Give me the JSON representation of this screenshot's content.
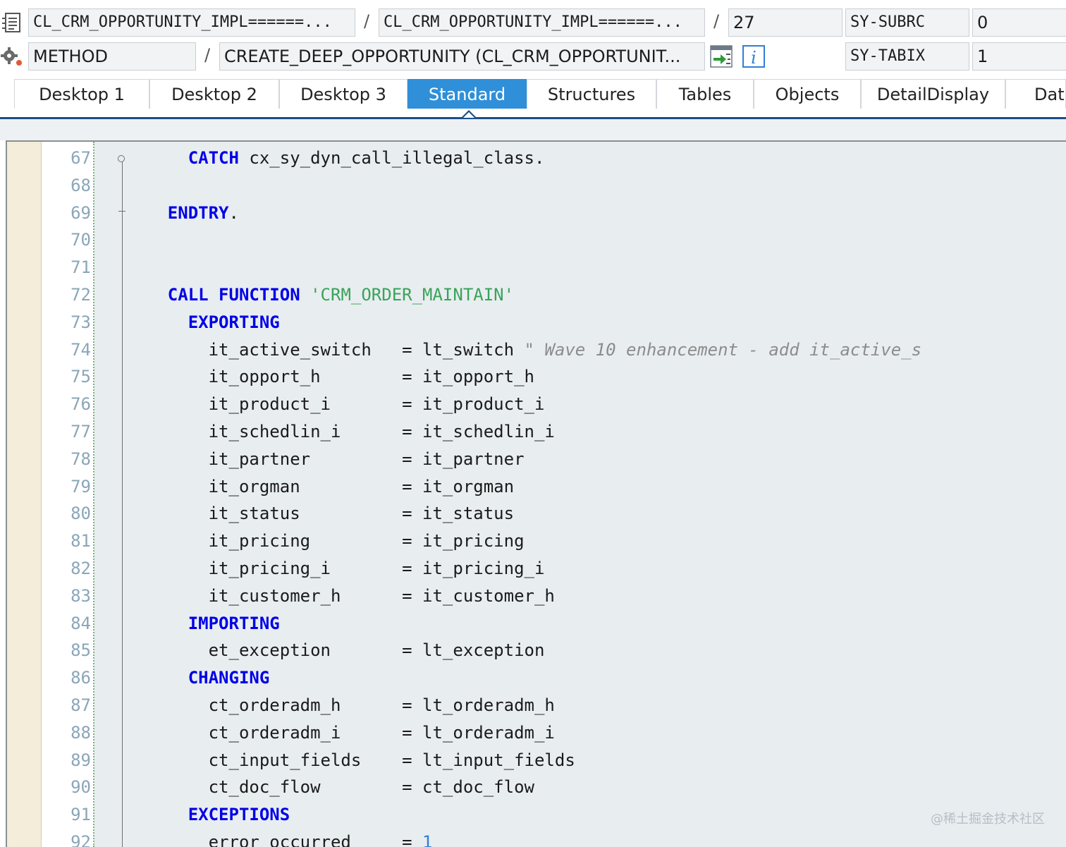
{
  "header": {
    "row1": {
      "program": "CL_CRM_OPPORTUNITY_IMPL======...",
      "include": "CL_CRM_OPPORTUNITY_IMPL======...",
      "line": "27",
      "sysvar_name": "SY-SUBRC",
      "sysvar_value": "0",
      "separator": "/",
      "icon": "source-code-icon"
    },
    "row2": {
      "event_type": "METHOD",
      "event_name": "CREATE_DEEP_OPPORTUNITY (CL_CRM_OPPORTUNIT...",
      "sysvar_name": "SY-TABIX",
      "sysvar_value": "1",
      "separator": "/",
      "icon": "gear-icon",
      "buttons": [
        "navigate-icon",
        "info-icon"
      ]
    }
  },
  "tabs": [
    {
      "label": "Desktop 1",
      "active": false
    },
    {
      "label": "Desktop 2",
      "active": false
    },
    {
      "label": "Desktop 3",
      "active": false
    },
    {
      "label": "Standard",
      "active": true
    },
    {
      "label": "Structures",
      "active": false
    },
    {
      "label": "Tables",
      "active": false
    },
    {
      "label": "Objects",
      "active": false
    },
    {
      "label": "DetailDisplay",
      "active": false
    },
    {
      "label": "Data",
      "active": false
    }
  ],
  "editor": {
    "lines": [
      {
        "n": "67",
        "tokens": [
          [
            "ws",
            "      "
          ],
          [
            "kw",
            "CATCH"
          ],
          [
            "id",
            " cx_sy_dyn_call_illegal_class."
          ]
        ]
      },
      {
        "n": "68",
        "tokens": []
      },
      {
        "n": "69",
        "tokens": [
          [
            "ws",
            "    "
          ],
          [
            "kw",
            "ENDTRY"
          ],
          [
            "id",
            "."
          ]
        ]
      },
      {
        "n": "70",
        "tokens": []
      },
      {
        "n": "71",
        "tokens": []
      },
      {
        "n": "72",
        "tokens": [
          [
            "ws",
            "    "
          ],
          [
            "kw",
            "CALL FUNCTION"
          ],
          [
            "id",
            " "
          ],
          [
            "str",
            "'CRM_ORDER_MAINTAIN'"
          ]
        ]
      },
      {
        "n": "73",
        "tokens": [
          [
            "ws",
            "      "
          ],
          [
            "kw",
            "EXPORTING"
          ]
        ]
      },
      {
        "n": "74",
        "tokens": [
          [
            "id",
            "        it_active_switch   = lt_switch "
          ],
          [
            "cmt",
            "\" Wave 10 enhancement - add it_active_s"
          ]
        ]
      },
      {
        "n": "75",
        "tokens": [
          [
            "id",
            "        it_opport_h        = it_opport_h"
          ]
        ]
      },
      {
        "n": "76",
        "tokens": [
          [
            "id",
            "        it_product_i       = it_product_i"
          ]
        ]
      },
      {
        "n": "77",
        "tokens": [
          [
            "id",
            "        it_schedlin_i      = it_schedlin_i"
          ]
        ]
      },
      {
        "n": "78",
        "tokens": [
          [
            "id",
            "        it_partner         = it_partner"
          ]
        ]
      },
      {
        "n": "79",
        "tokens": [
          [
            "id",
            "        it_orgman          = it_orgman"
          ]
        ]
      },
      {
        "n": "80",
        "tokens": [
          [
            "id",
            "        it_status          = it_status"
          ]
        ]
      },
      {
        "n": "81",
        "tokens": [
          [
            "id",
            "        it_pricing         = it_pricing"
          ]
        ]
      },
      {
        "n": "82",
        "tokens": [
          [
            "id",
            "        it_pricing_i       = it_pricing_i"
          ]
        ]
      },
      {
        "n": "83",
        "tokens": [
          [
            "id",
            "        it_customer_h      = it_customer_h"
          ]
        ]
      },
      {
        "n": "84",
        "tokens": [
          [
            "ws",
            "      "
          ],
          [
            "kw",
            "IMPORTING"
          ]
        ]
      },
      {
        "n": "85",
        "tokens": [
          [
            "id",
            "        et_exception       = lt_exception"
          ]
        ]
      },
      {
        "n": "86",
        "tokens": [
          [
            "ws",
            "      "
          ],
          [
            "kw",
            "CHANGING"
          ]
        ]
      },
      {
        "n": "87",
        "tokens": [
          [
            "id",
            "        ct_orderadm_h      = lt_orderadm_h"
          ]
        ]
      },
      {
        "n": "88",
        "tokens": [
          [
            "id",
            "        ct_orderadm_i      = lt_orderadm_i"
          ]
        ]
      },
      {
        "n": "89",
        "tokens": [
          [
            "id",
            "        ct_input_fields    = lt_input_fields"
          ]
        ]
      },
      {
        "n": "90",
        "tokens": [
          [
            "id",
            "        ct_doc_flow        = ct_doc_flow"
          ]
        ]
      },
      {
        "n": "91",
        "tokens": [
          [
            "ws",
            "      "
          ],
          [
            "kw",
            "EXCEPTIONS"
          ]
        ]
      },
      {
        "n": "92",
        "tokens": [
          [
            "id",
            "        error_occurred     = "
          ],
          [
            "num",
            "1"
          ]
        ]
      }
    ]
  },
  "watermark": "@稀土掘金技术社区",
  "colors": {
    "keyword": "#0000e8",
    "string": "#3aa35a",
    "comment": "#8c8c8c",
    "number": "#2f7fd8",
    "active_tab": "#2f8fd8",
    "editor_bg": "#e8edf0"
  }
}
